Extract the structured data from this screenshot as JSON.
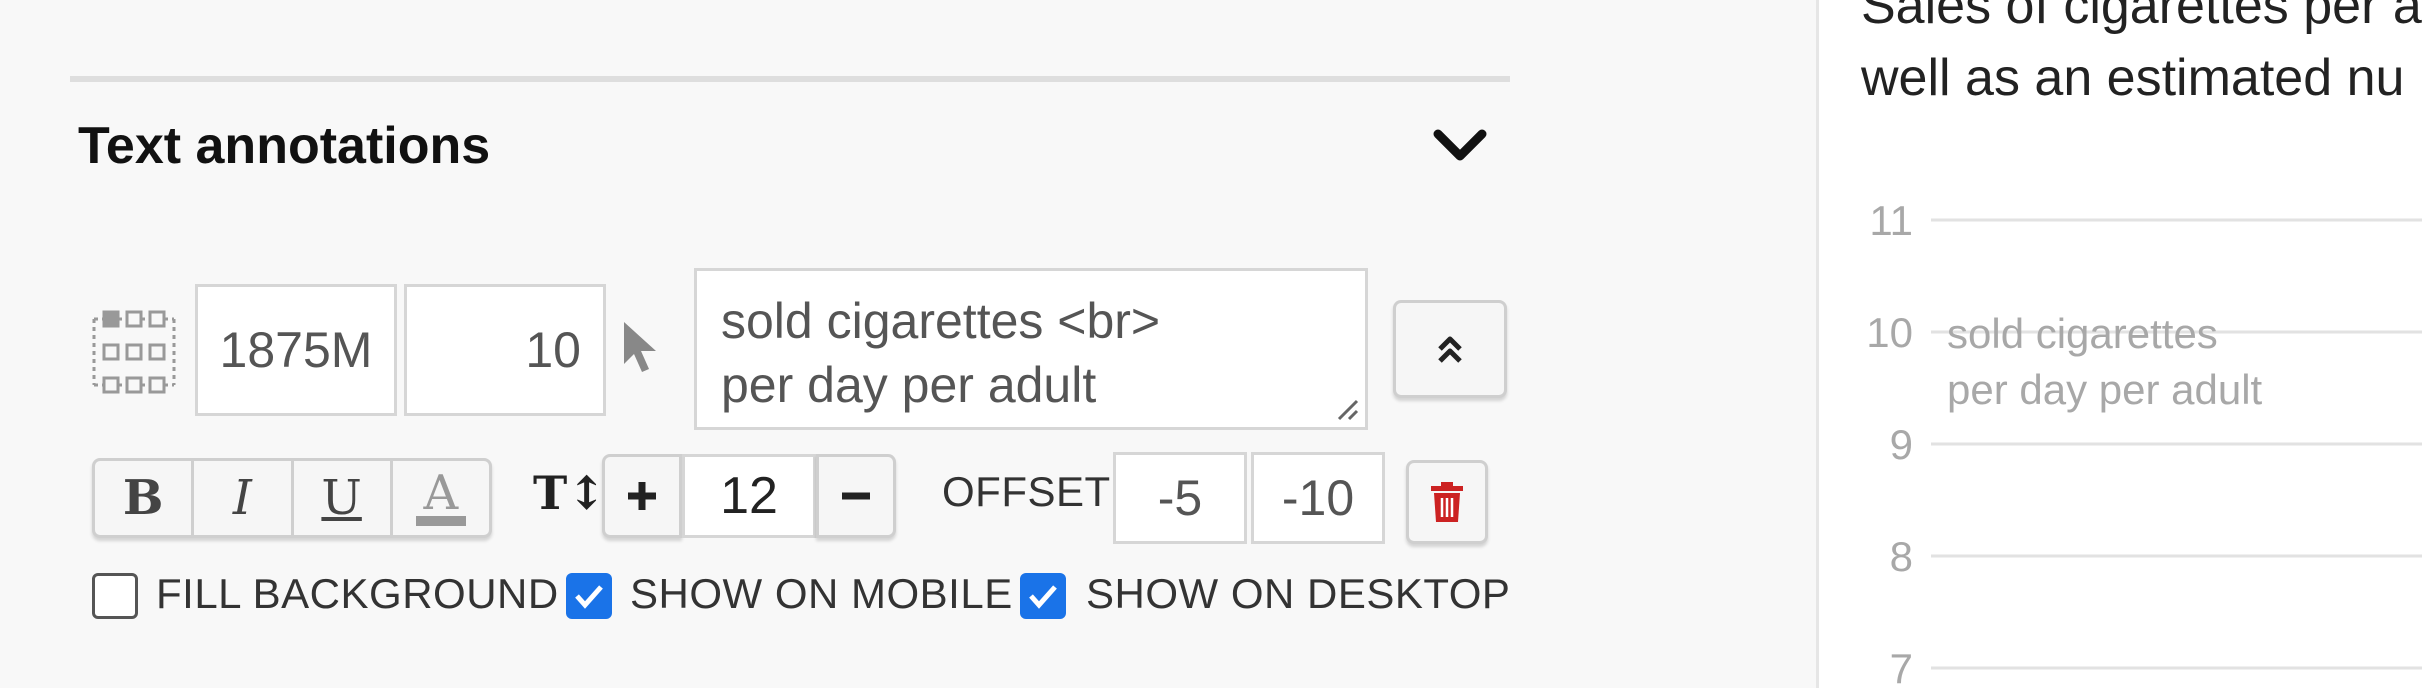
{
  "section": {
    "title": "Text annotations"
  },
  "annotation": {
    "x_value": "1875M",
    "y_value": "10",
    "text": "sold cigarettes <br>\nper day per adult",
    "font_size": "12",
    "offset_label": "OFFSET",
    "offset_x": "-5",
    "offset_y": "-10"
  },
  "format_buttons": {
    "bold": "B",
    "italic": "I",
    "underline": "U",
    "color": "A",
    "text_size_icon": "T↕"
  },
  "options": {
    "fill_background": {
      "label": "FILL BACKGROUND",
      "checked": false
    },
    "show_on_mobile": {
      "label": "SHOW ON MOBILE",
      "checked": true
    },
    "show_on_desktop": {
      "label": "SHOW ON DESKTOP",
      "checked": true
    }
  },
  "chart_preview": {
    "description_line1": "Sales of cigarettes per a",
    "description_line2": "well as an estimated nu",
    "annotation_line1": "sold cigarettes",
    "annotation_line2": "per day per adult"
  },
  "chart_data": {
    "type": "line",
    "y_ticks": [
      "11",
      "10",
      "9",
      "8",
      "7"
    ],
    "grid": true
  },
  "colors": {
    "accent": "#1a73e8",
    "delete": "#cc2222",
    "grid": "#e2e2e2",
    "tick": "#a8a8a8"
  }
}
